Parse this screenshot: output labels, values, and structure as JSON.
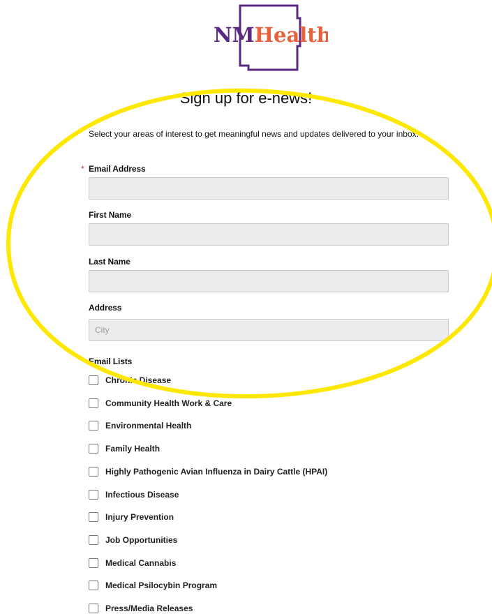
{
  "brand": {
    "logo_nm": "NM",
    "logo_health": "Health",
    "color_nm": "#5a2a82",
    "color_health": "#e8613c",
    "outline_color": "#5a2a82"
  },
  "form": {
    "title": "Sign up for e-news!",
    "intro": "Select your areas of interest to get meaningful news and updates delivered to your inbox.",
    "required_mark": "*",
    "email_label": "Email Address",
    "first_name_label": "First Name",
    "last_name_label": "Last Name",
    "address_label": "Address",
    "city_placeholder": "City",
    "email_lists_label": "Email Lists",
    "lists": [
      "Chronic Disease",
      "Community Health Work & Care",
      "Environmental Health",
      "Family Health",
      "Highly Pathogenic Avian Influenza in Dairy Cattle (HPAI)",
      "Infectious Disease",
      "Injury Prevention",
      "Job Opportunities",
      "Medical Cannabis",
      "Medical Psilocybin Program",
      "Press/Media Releases"
    ]
  },
  "annotation": {
    "ellipse_color": "#ffe800"
  }
}
